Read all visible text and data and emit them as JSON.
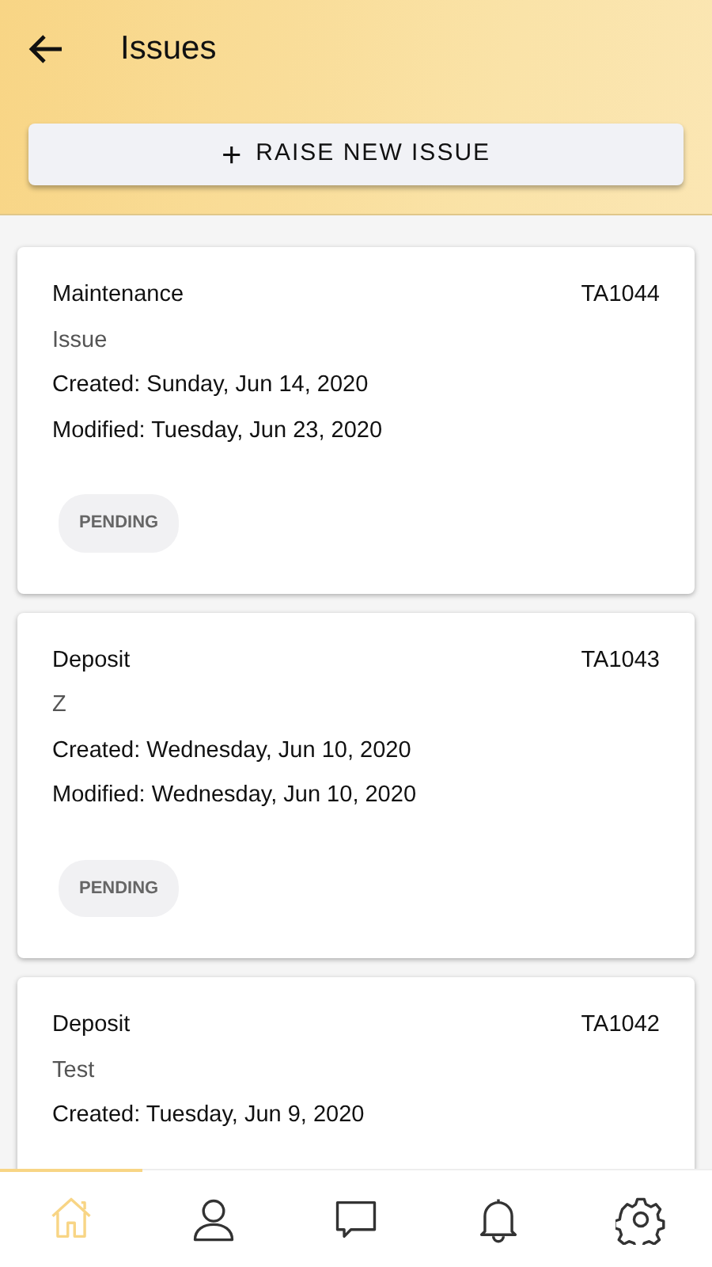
{
  "header": {
    "title": "Issues",
    "action_button": {
      "icon": "+",
      "label": "RAISE NEW ISSUE"
    }
  },
  "issues": [
    {
      "category": "Maintenance",
      "code": "TA1044",
      "subject": "Issue",
      "created": "Created: Sunday, Jun 14, 2020",
      "modified": "Modified: Tuesday, Jun 23, 2020",
      "status": "PENDING"
    },
    {
      "category": "Deposit",
      "code": "TA1043",
      "subject": "Z",
      "created": "Created: Wednesday, Jun 10, 2020",
      "modified": "Modified: Wednesday, Jun 10, 2020",
      "status": "PENDING"
    },
    {
      "category": "Deposit",
      "code": "TA1042",
      "subject": "Test",
      "created": "Created: Tuesday, Jun 9, 2020"
    }
  ],
  "bottom_nav": [
    {
      "kind": "home",
      "selected": true
    },
    {
      "kind": "profile",
      "selected": false
    },
    {
      "kind": "chat",
      "selected": false
    },
    {
      "kind": "bell",
      "selected": false
    },
    {
      "kind": "settings",
      "selected": false
    }
  ]
}
